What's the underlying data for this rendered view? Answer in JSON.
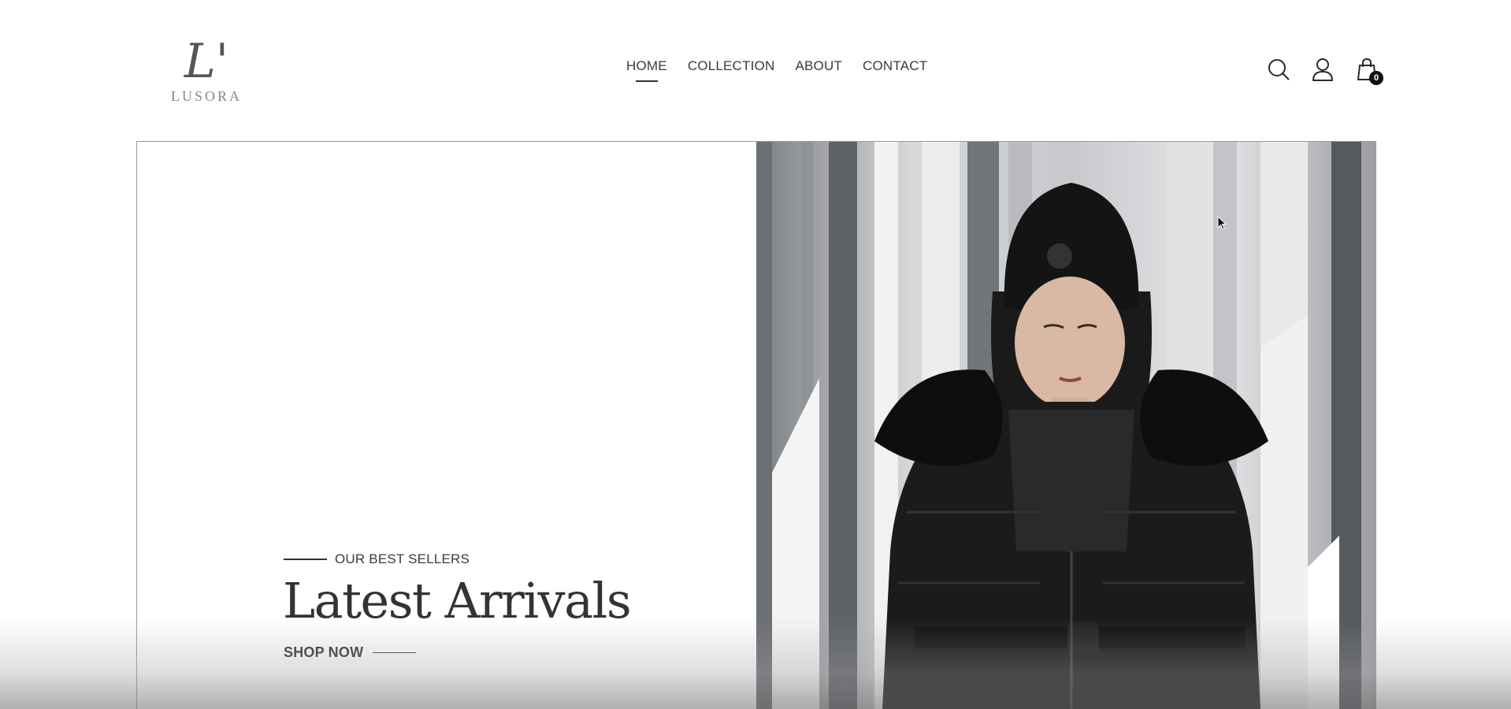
{
  "brand": {
    "logo_mark": "L'",
    "logo_text": "LUSORA"
  },
  "nav": {
    "items": [
      {
        "label": "HOME",
        "active": true
      },
      {
        "label": "COLLECTION",
        "active": false
      },
      {
        "label": "ABOUT",
        "active": false
      },
      {
        "label": "CONTACT",
        "active": false
      }
    ]
  },
  "header_icons": {
    "search": "search-icon",
    "account": "user-icon",
    "cart": "shopping-bag-icon",
    "cart_count": "0"
  },
  "hero": {
    "kicker": "OUR BEST SELLERS",
    "title": "Latest Arrivals",
    "cta": "SHOP NOW",
    "image_alt": "model-in-black-puffer-coat"
  },
  "colors": {
    "text": "#3a3a3a",
    "accent": "#111111",
    "background": "#ffffff"
  }
}
